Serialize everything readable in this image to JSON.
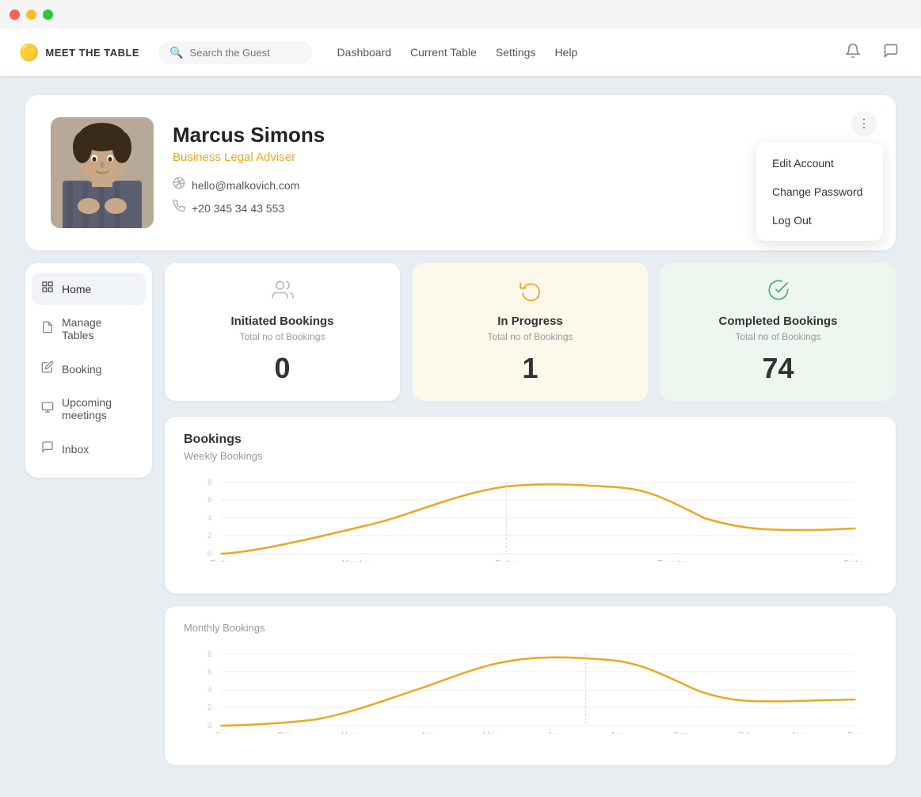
{
  "titlebar": {
    "buttons": [
      "close",
      "minimize",
      "maximize"
    ]
  },
  "navbar": {
    "logo_icon": "🟡",
    "logo_text": "MEET THE TABLE",
    "search_placeholder": "Search the Guest",
    "nav_links": [
      {
        "label": "Dashboard",
        "id": "dashboard"
      },
      {
        "label": "Current Table",
        "id": "current-table"
      },
      {
        "label": "Settings",
        "id": "settings"
      },
      {
        "label": "Help",
        "id": "help"
      }
    ]
  },
  "profile": {
    "name": "Marcus Simons",
    "title": "Business Legal Adviser",
    "email": "hello@malkovich.com",
    "phone": "+20 345 34 43 553"
  },
  "dropdown": {
    "items": [
      {
        "label": "Edit Account",
        "id": "edit-account"
      },
      {
        "label": "Change Password",
        "id": "change-password"
      },
      {
        "label": "Log Out",
        "id": "log-out"
      }
    ]
  },
  "sidebar": {
    "items": [
      {
        "label": "Home",
        "icon": "⊞",
        "id": "home",
        "active": true
      },
      {
        "label": "Manage Tables",
        "icon": "📄",
        "id": "manage-tables"
      },
      {
        "label": "Booking",
        "icon": "✏️",
        "id": "booking"
      },
      {
        "label": "Upcoming meetings",
        "icon": "🖥",
        "id": "upcoming-meetings"
      },
      {
        "label": "Inbox",
        "icon": "💬",
        "id": "inbox"
      }
    ]
  },
  "stats": [
    {
      "label": "Initiated Bookings",
      "sublabel": "Total no of Bookings",
      "value": "0",
      "type": "white",
      "icon": "👥"
    },
    {
      "label": "In Progress",
      "sublabel": "Total no of Bookings",
      "value": "1",
      "type": "yellow",
      "icon": "🔄"
    },
    {
      "label": "Completed Bookings",
      "sublabel": "Total no of Bookings",
      "value": "74",
      "type": "green",
      "icon": "✅"
    }
  ],
  "bookings_section": {
    "title": "Bookings"
  },
  "weekly_chart": {
    "title": "Weekly Bookings",
    "y_labels": [
      "8",
      "6",
      "4",
      "2",
      "0"
    ],
    "x_labels": [
      "Friday",
      "Monday",
      "Friday",
      "Tuesday",
      "Friday"
    ],
    "data_points": [
      {
        "x": 0,
        "y": 0.05
      },
      {
        "x": 0.25,
        "y": 0.3
      },
      {
        "x": 0.45,
        "y": 0.85
      },
      {
        "x": 0.55,
        "y": 0.95
      },
      {
        "x": 0.7,
        "y": 0.6
      },
      {
        "x": 0.85,
        "y": 0.5
      },
      {
        "x": 1.0,
        "y": 0.5
      }
    ]
  },
  "monthly_chart": {
    "title": "Monthly Bookings",
    "y_labels": [
      "8",
      "6",
      "4",
      "2",
      "0"
    ],
    "x_labels": [
      "Jan",
      "Dec",
      "Mar",
      "Apr",
      "May",
      "Jun",
      "Aug",
      "Sep",
      "Oct",
      "Nov",
      "Dec"
    ]
  }
}
